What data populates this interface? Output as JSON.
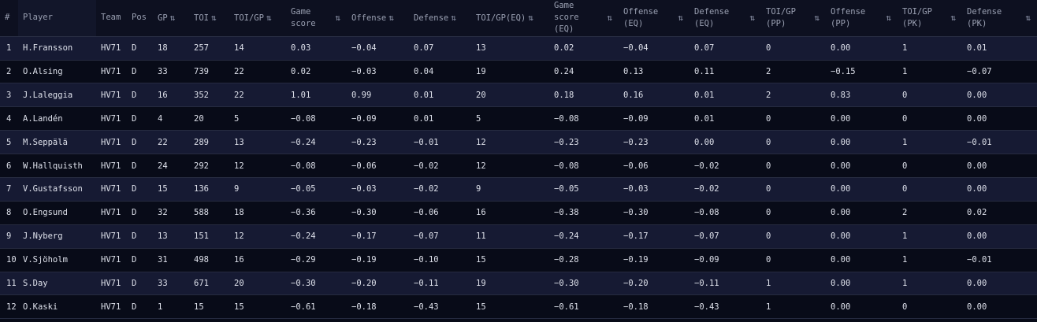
{
  "columns": [
    {
      "label": "#",
      "sortable": false
    },
    {
      "label": "Player",
      "sortable": false
    },
    {
      "label": "Team",
      "sortable": false
    },
    {
      "label": "Pos",
      "sortable": false
    },
    {
      "label": "GP",
      "sortable": true
    },
    {
      "label": "TOI",
      "sortable": true
    },
    {
      "label": "TOI/GP",
      "sortable": true
    },
    {
      "label": "Game score",
      "sortable": true
    },
    {
      "label": "Offense",
      "sortable": true
    },
    {
      "label": "Defense",
      "sortable": true
    },
    {
      "label": "TOI/GP(EQ)",
      "sortable": true
    },
    {
      "label": "Game score (EQ)",
      "sortable": true
    },
    {
      "label": "Offense (EQ)",
      "sortable": true
    },
    {
      "label": "Defense (EQ)",
      "sortable": true
    },
    {
      "label": "TOI/GP (PP)",
      "sortable": true
    },
    {
      "label": "Offense (PP)",
      "sortable": true
    },
    {
      "label": "TOI/GP (PK)",
      "sortable": true
    },
    {
      "label": "Defense (PK)",
      "sortable": true
    }
  ],
  "sort_icon": "⇅",
  "rows": [
    [
      "1",
      "H.Fransson",
      "HV71",
      "D",
      "18",
      "257",
      "14",
      "0.03",
      "−0.04",
      "0.07",
      "13",
      "0.02",
      "−0.04",
      "0.07",
      "0",
      "0.00",
      "1",
      "0.01"
    ],
    [
      "2",
      "O.Alsing",
      "HV71",
      "D",
      "33",
      "739",
      "22",
      "0.02",
      "−0.03",
      "0.04",
      "19",
      "0.24",
      "0.13",
      "0.11",
      "2",
      "−0.15",
      "1",
      "−0.07"
    ],
    [
      "3",
      "J.Laleggia",
      "HV71",
      "D",
      "16",
      "352",
      "22",
      "1.01",
      "0.99",
      "0.01",
      "20",
      "0.18",
      "0.16",
      "0.01",
      "2",
      "0.83",
      "0",
      "0.00"
    ],
    [
      "4",
      "A.Landén",
      "HV71",
      "D",
      "4",
      "20",
      "5",
      "−0.08",
      "−0.09",
      "0.01",
      "5",
      "−0.08",
      "−0.09",
      "0.01",
      "0",
      "0.00",
      "0",
      "0.00"
    ],
    [
      "5",
      "M.Seppälä",
      "HV71",
      "D",
      "22",
      "289",
      "13",
      "−0.24",
      "−0.23",
      "−0.01",
      "12",
      "−0.23",
      "−0.23",
      "0.00",
      "0",
      "0.00",
      "1",
      "−0.01"
    ],
    [
      "6",
      "W.Hallquisth",
      "HV71",
      "D",
      "24",
      "292",
      "12",
      "−0.08",
      "−0.06",
      "−0.02",
      "12",
      "−0.08",
      "−0.06",
      "−0.02",
      "0",
      "0.00",
      "0",
      "0.00"
    ],
    [
      "7",
      "V.Gustafsson",
      "HV71",
      "D",
      "15",
      "136",
      "9",
      "−0.05",
      "−0.03",
      "−0.02",
      "9",
      "−0.05",
      "−0.03",
      "−0.02",
      "0",
      "0.00",
      "0",
      "0.00"
    ],
    [
      "8",
      "O.Engsund",
      "HV71",
      "D",
      "32",
      "588",
      "18",
      "−0.36",
      "−0.30",
      "−0.06",
      "16",
      "−0.38",
      "−0.30",
      "−0.08",
      "0",
      "0.00",
      "2",
      "0.02"
    ],
    [
      "9",
      "J.Nyberg",
      "HV71",
      "D",
      "13",
      "151",
      "12",
      "−0.24",
      "−0.17",
      "−0.07",
      "11",
      "−0.24",
      "−0.17",
      "−0.07",
      "0",
      "0.00",
      "1",
      "0.00"
    ],
    [
      "10",
      "V.Sjöholm",
      "HV71",
      "D",
      "31",
      "498",
      "16",
      "−0.29",
      "−0.19",
      "−0.10",
      "15",
      "−0.28",
      "−0.19",
      "−0.09",
      "0",
      "0.00",
      "1",
      "−0.01"
    ],
    [
      "11",
      "S.Day",
      "HV71",
      "D",
      "33",
      "671",
      "20",
      "−0.30",
      "−0.20",
      "−0.11",
      "19",
      "−0.30",
      "−0.20",
      "−0.11",
      "1",
      "0.00",
      "1",
      "0.00"
    ],
    [
      "12",
      "O.Kaski",
      "HV71",
      "D",
      "1",
      "15",
      "15",
      "−0.61",
      "−0.18",
      "−0.43",
      "15",
      "−0.61",
      "−0.18",
      "−0.43",
      "1",
      "0.00",
      "0",
      "0.00"
    ]
  ]
}
